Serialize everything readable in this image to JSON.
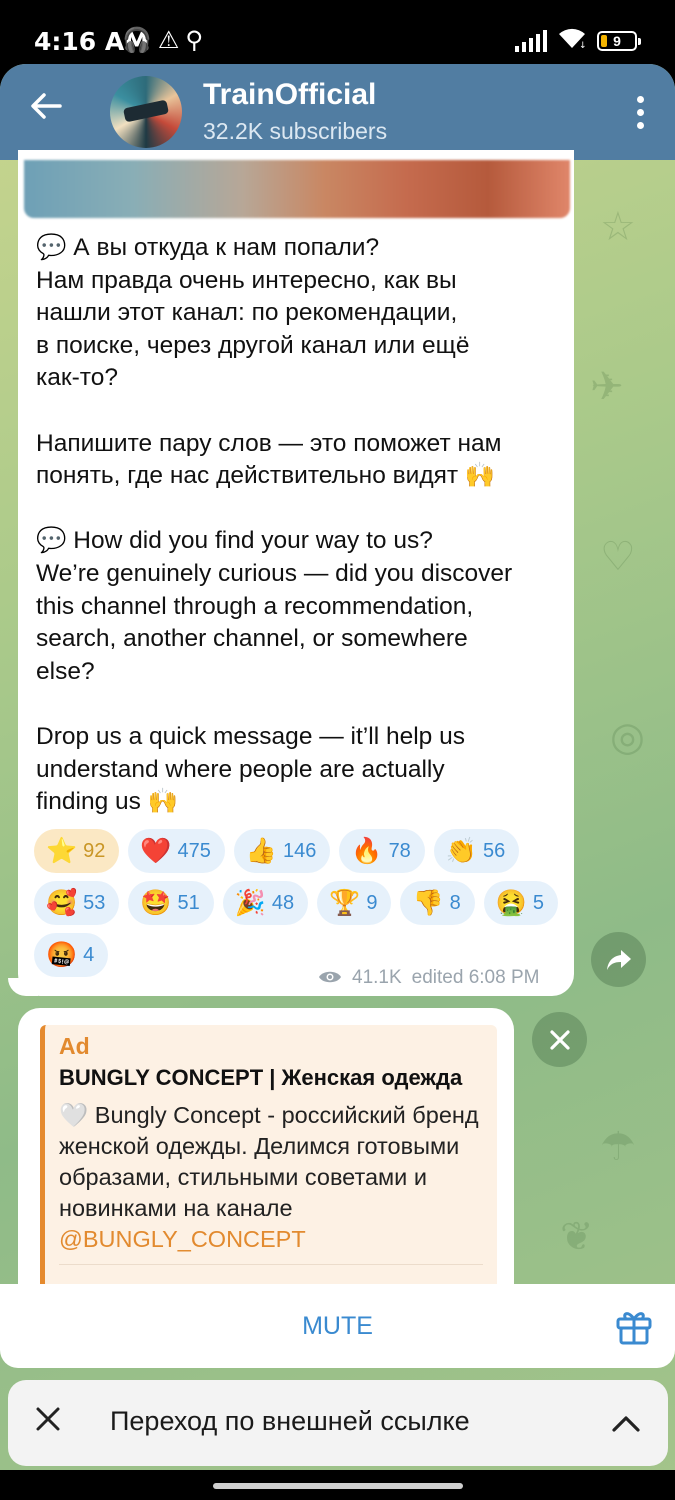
{
  "status_bar": {
    "time": "4:16 AM",
    "left_icons": [
      "headphones-icon",
      "warning-icon",
      "usb-icon"
    ],
    "battery": "9"
  },
  "header": {
    "title": "TrainOfficial",
    "subtitle": "32.2K subscribers"
  },
  "message": {
    "text": "💬 А вы откуда к нам попали?\nНам правда очень интересно, как вы\nнашли этот канал: по рекомендации,\nв поиске, через другой канал или ещё\nкак-то?\n\nНапишите пару слов — это поможет нам\nпонять, где нас действительно видят 🙌\n\n💬 How did you find your way to us?\nWe’re genuinely curious — did you discover\nthis channel through a recommendation,\nsearch, another channel, or somewhere\nelse?\n\nDrop us a quick message — it’ll help us\nunderstand where people are actually\nfinding us 🙌",
    "reactions": [
      {
        "emoji": "⭐",
        "count": "92",
        "active": true
      },
      {
        "emoji": "❤️",
        "count": "475"
      },
      {
        "emoji": "👍",
        "count": "146"
      },
      {
        "emoji": "🔥",
        "count": "78"
      },
      {
        "emoji": "👏",
        "count": "56"
      },
      {
        "emoji": "🥰",
        "count": "53"
      },
      {
        "emoji": "🤩",
        "count": "51"
      },
      {
        "emoji": "🎉",
        "count": "48"
      },
      {
        "emoji": "🏆",
        "count": "9"
      },
      {
        "emoji": "👎",
        "count": "8"
      },
      {
        "emoji": "🤮",
        "count": "5"
      },
      {
        "emoji": "🤬",
        "count": "4"
      }
    ],
    "views": "41.1K",
    "edited": "edited 6:08 PM"
  },
  "ad": {
    "label": "Ad",
    "title": "BUNGLY CONCEPT | Женская одежда",
    "body": "🤍 Bungly Concept - российский бренд женской одежды. Делимся готовыми образами, стильными советами и новинками на канале ",
    "link": "@BUNGLY_CONCEPT"
  },
  "bottom": {
    "mute_label": "MUTE"
  },
  "link_bar": {
    "title": "Переход по внешней ссылке"
  },
  "colors": {
    "header": "#517da2",
    "accent": "#3a8ad0",
    "ad_accent": "#e28a2f"
  }
}
